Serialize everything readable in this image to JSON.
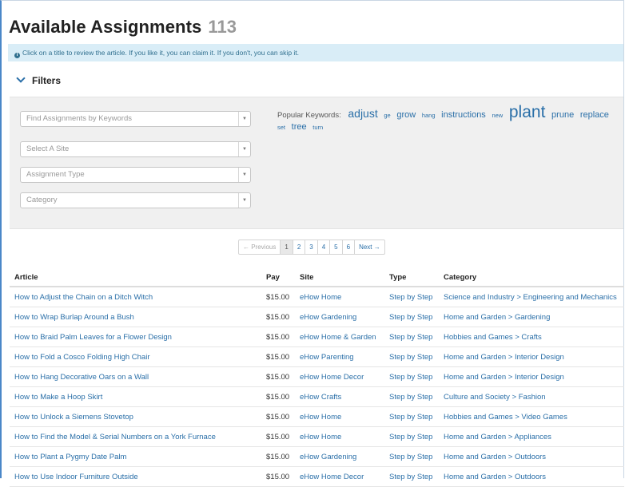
{
  "page": {
    "title": "Available Assignments",
    "count": "113",
    "info": "Click on a title to review the article. If you like it, you can claim it. If you don't, you can skip it."
  },
  "filters": {
    "heading": "Filters",
    "keywords_placeholder": "Find Assignments by Keywords",
    "site_placeholder": "Select A Site",
    "type_placeholder": "Assignment Type",
    "category_placeholder": "Category",
    "popular_label": "Popular Keywords:",
    "popular_keywords": [
      {
        "word": "adjust",
        "size": "l"
      },
      {
        "word": "ge",
        "size": "xs"
      },
      {
        "word": "grow",
        "size": "m"
      },
      {
        "word": "hang",
        "size": "xs"
      },
      {
        "word": "instructions",
        "size": "m"
      },
      {
        "word": "new",
        "size": "xs"
      },
      {
        "word": "plant",
        "size": "xl"
      },
      {
        "word": "prune",
        "size": "m"
      },
      {
        "word": "replace",
        "size": "m"
      },
      {
        "word": "set",
        "size": "xs"
      },
      {
        "word": "tree",
        "size": "m"
      },
      {
        "word": "turn",
        "size": "xs"
      }
    ]
  },
  "pagination": {
    "previous": "← Previous",
    "pages": [
      "1",
      "2",
      "3",
      "4",
      "5",
      "6"
    ],
    "next": "Next →",
    "active": "1"
  },
  "table": {
    "headers": [
      "Article",
      "Pay",
      "Site",
      "Type",
      "Category"
    ],
    "rows": [
      {
        "article": "How to Adjust the Chain on a Ditch Witch",
        "pay": "$15.00",
        "site": "eHow Home",
        "type": "Step by Step",
        "category": "Science and Industry > Engineering and Mechanics"
      },
      {
        "article": "How to Wrap Burlap Around a Bush",
        "pay": "$15.00",
        "site": "eHow Gardening",
        "type": "Step by Step",
        "category": "Home and Garden > Gardening"
      },
      {
        "article": "How to Braid Palm Leaves for a Flower Design",
        "pay": "$15.00",
        "site": "eHow Home & Garden",
        "type": "Step by Step",
        "category": "Hobbies and Games > Crafts"
      },
      {
        "article": "How to Fold a Cosco Folding High Chair",
        "pay": "$15.00",
        "site": "eHow Parenting",
        "type": "Step by Step",
        "category": "Home and Garden > Interior Design"
      },
      {
        "article": "How to Hang Decorative Oars on a Wall",
        "pay": "$15.00",
        "site": "eHow Home Decor",
        "type": "Step by Step",
        "category": "Home and Garden > Interior Design"
      },
      {
        "article": "How to Make a Hoop Skirt",
        "pay": "$15.00",
        "site": "eHow Crafts",
        "type": "Step by Step",
        "category": "Culture and Society > Fashion"
      },
      {
        "article": "How to Unlock a Siemens Stovetop",
        "pay": "$15.00",
        "site": "eHow Home",
        "type": "Step by Step",
        "category": "Hobbies and Games > Video Games"
      },
      {
        "article": "How to Find the Model & Serial Numbers on a York Furnace",
        "pay": "$15.00",
        "site": "eHow Home",
        "type": "Step by Step",
        "category": "Home and Garden > Appliances"
      },
      {
        "article": "How to Plant a Pygmy Date Palm",
        "pay": "$15.00",
        "site": "eHow Gardening",
        "type": "Step by Step",
        "category": "Home and Garden > Outdoors"
      },
      {
        "article": "How to Use Indoor Furniture Outside",
        "pay": "$15.00",
        "site": "eHow Home Decor",
        "type": "Step by Step",
        "category": "Home and Garden > Outdoors"
      }
    ]
  }
}
